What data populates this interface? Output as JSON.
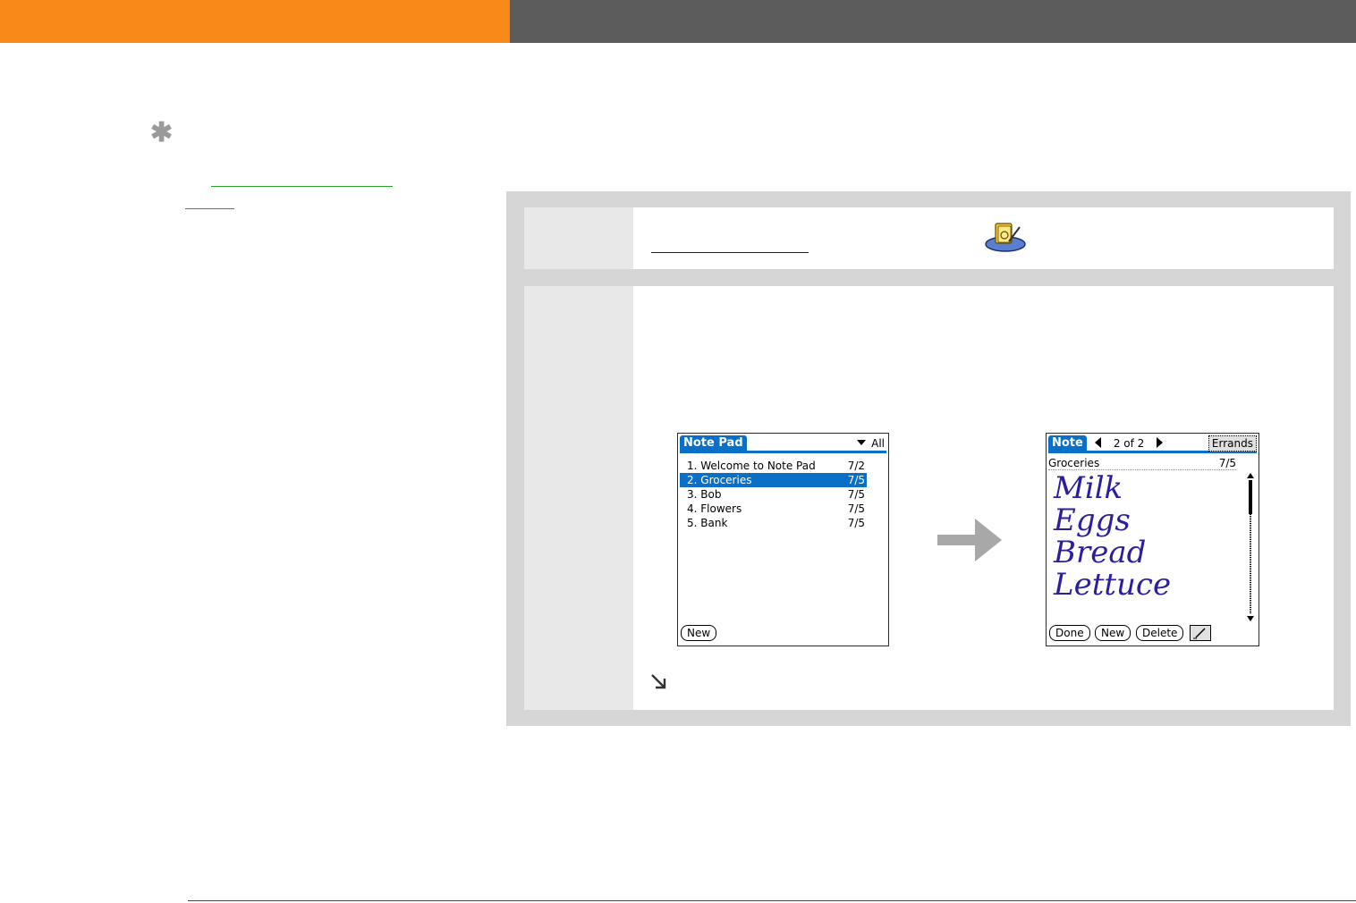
{
  "colors": {
    "accent": "#f98a1a",
    "header_gray": "#5c5c5c",
    "palm_blue": "#0a6fc6",
    "ink": "#2a1fa0",
    "link_green": "#2aa22a"
  },
  "sidebar": {
    "tip_icon": "asterisk-icon"
  },
  "notepad_list": {
    "title": "Note Pad",
    "category": "All",
    "notes": [
      {
        "label": "1.  Welcome to Note Pad",
        "date": "7/2",
        "selected": false
      },
      {
        "label": "2.  Groceries",
        "date": "7/5",
        "selected": true
      },
      {
        "label": "3.  Bob",
        "date": "7/5",
        "selected": false
      },
      {
        "label": "4.  Flowers",
        "date": "7/5",
        "selected": false
      },
      {
        "label": "5.  Bank",
        "date": "7/5",
        "selected": false
      }
    ],
    "new_button": "New"
  },
  "note_view": {
    "title": "Note",
    "page_indicator": "2 of 2",
    "category": "Errands",
    "note_title": "Groceries",
    "note_date": "7/5",
    "handwriting": [
      "Milk",
      "Eggs",
      "Bread",
      "Lettuce"
    ],
    "buttons": {
      "done": "Done",
      "new": "New",
      "delete": "Delete"
    }
  }
}
